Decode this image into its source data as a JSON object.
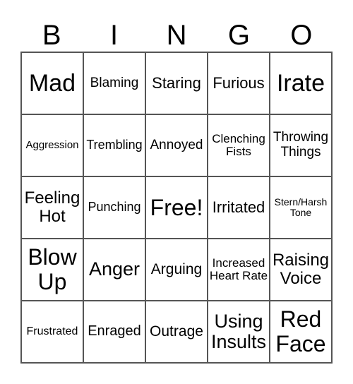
{
  "header": [
    "B",
    "I",
    "N",
    "G",
    "O"
  ],
  "cells": [
    "Mad",
    "Blaming",
    "Staring",
    "Furious",
    "Irate",
    "Aggression",
    "Trembling",
    "Annoyed",
    "Clenching Fists",
    "Throwing Things",
    "Feeling Hot",
    "Punching",
    "Free!",
    "Irritated",
    "Stern/Harsh Tone",
    "Blow Up",
    "Anger",
    "Arguing",
    "Increased Heart Rate",
    "Raising Voice",
    "Frustrated",
    "Enraged",
    "Outrage",
    "Using Insults",
    "Red Face"
  ]
}
